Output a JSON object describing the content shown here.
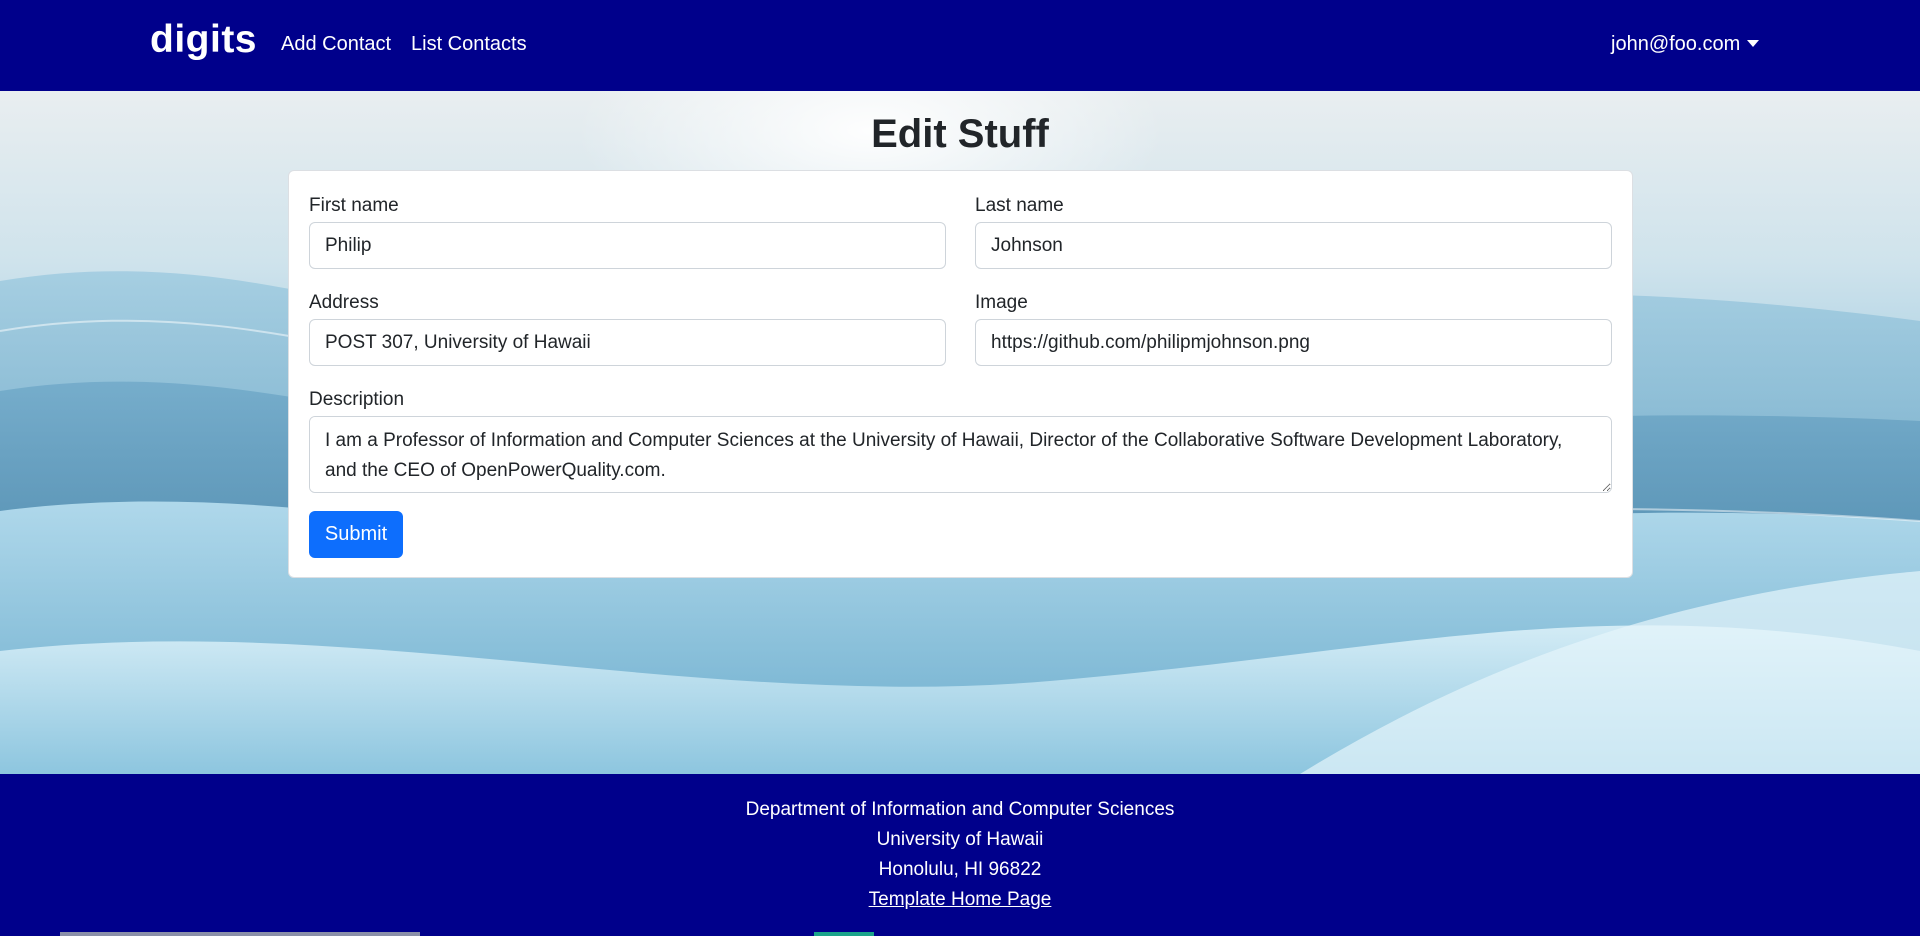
{
  "navbar": {
    "brand": "digits",
    "links": [
      {
        "label": "Add Contact"
      },
      {
        "label": "List Contacts"
      }
    ],
    "user": "john@foo.com"
  },
  "page": {
    "title": "Edit Stuff"
  },
  "form": {
    "first_name": {
      "label": "First name",
      "value": "Philip"
    },
    "last_name": {
      "label": "Last name",
      "value": "Johnson"
    },
    "address": {
      "label": "Address",
      "value": "POST 307, University of Hawaii"
    },
    "image": {
      "label": "Image",
      "value": "https://github.com/philipmjohnson.png"
    },
    "description": {
      "label": "Description",
      "value": "I am a Professor of Information and Computer Sciences at the University of Hawaii, Director of the Collaborative Software Development Laboratory, and the CEO of OpenPowerQuality.com."
    },
    "submit_label": "Submit"
  },
  "footer": {
    "line1": "Department of Information and Computer Sciences",
    "line2": "University of Hawaii",
    "line3": "Honolulu, HI 96822",
    "link": "Template Home Page"
  },
  "colors": {
    "navbar": "#00008b",
    "submit": "#0d6efd"
  }
}
